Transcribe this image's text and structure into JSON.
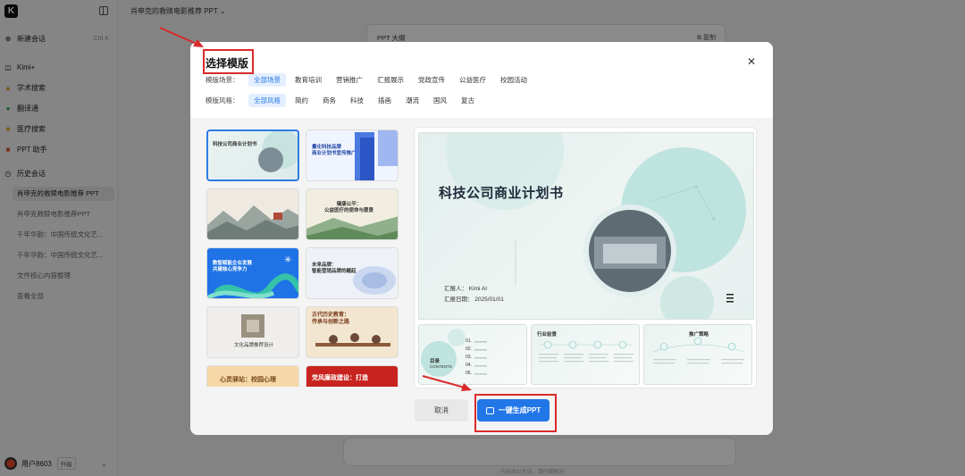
{
  "sidebar": {
    "new_chat": "新建会话",
    "new_chat_shortcut": "Ctrl  K",
    "kimi_plus": "Kimi+",
    "tools": [
      {
        "label": "学术搜索"
      },
      {
        "label": "翻译通"
      },
      {
        "label": "医疗搜索"
      },
      {
        "label": "PPT 助手"
      }
    ],
    "history_label": "历史会话",
    "history": [
      {
        "label": "肖申克的救赎电影推荐 PPT"
      },
      {
        "label": "肖申克救赎电影推荐PPT"
      },
      {
        "label": "千年华韵：中国传统文化艺..."
      },
      {
        "label": "千年华韵：中国传统文化艺..."
      },
      {
        "label": "文件核心内容整理"
      },
      {
        "label": "查看全部"
      }
    ],
    "user_name": "用户8603",
    "upgrade_label": "升级"
  },
  "topbar": {
    "title": "肖申克的救赎电影推荐 PPT"
  },
  "background": {
    "card_title": "PPT 大纲",
    "copy_label": "复制",
    "hint": "内容由AI生成，请仔细甄别"
  },
  "modal": {
    "title": "选择模版",
    "scene_label": "模版场景：",
    "scenes": [
      "全部场景",
      "教育培训",
      "营销推广",
      "汇报展示",
      "党政宣传",
      "公益医疗",
      "校园活动"
    ],
    "style_label": "模版风格：",
    "styles": [
      "全部风格",
      "简约",
      "商务",
      "科技",
      "插画",
      "潮流",
      "国风",
      "复古"
    ],
    "templates": [
      {
        "title": "科技公司商业计划书"
      },
      {
        "title": "量化科技品牌\n商业计划书宣传推广"
      },
      {
        "title": ""
      },
      {
        "title": "健康公平：\n公益医疗的使命与愿景"
      },
      {
        "title": "数智赋能企业发展\n共建核心竞争力"
      },
      {
        "title": "未来品牌：\n智能营销品牌的崛起"
      },
      {
        "title": "文化品牌推荐设计"
      },
      {
        "title": "古代历史教育：\n传承与创新之路"
      },
      {
        "title": "心灵驿站：校园心理"
      },
      {
        "title": "党风廉政建设：打造"
      }
    ],
    "preview": {
      "title": "科技公司商业计划书",
      "reporter": "汇报人：  Kimi AI",
      "date": "汇报日期：  2025/01/01",
      "sub1_title": "目录",
      "sub1_en": "CONTENTS",
      "sub1_items": [
        "01.",
        "02.",
        "03.",
        "04.",
        "05."
      ],
      "sub2_title": "行业前景",
      "sub3_title": "推广策略"
    },
    "cancel_label": "取消",
    "generate_label": "一键生成PPT"
  },
  "colors": {
    "accent": "#2277e8",
    "annotation": "#d92a2a",
    "overlay": "rgba(0,0,0,0.46)"
  }
}
